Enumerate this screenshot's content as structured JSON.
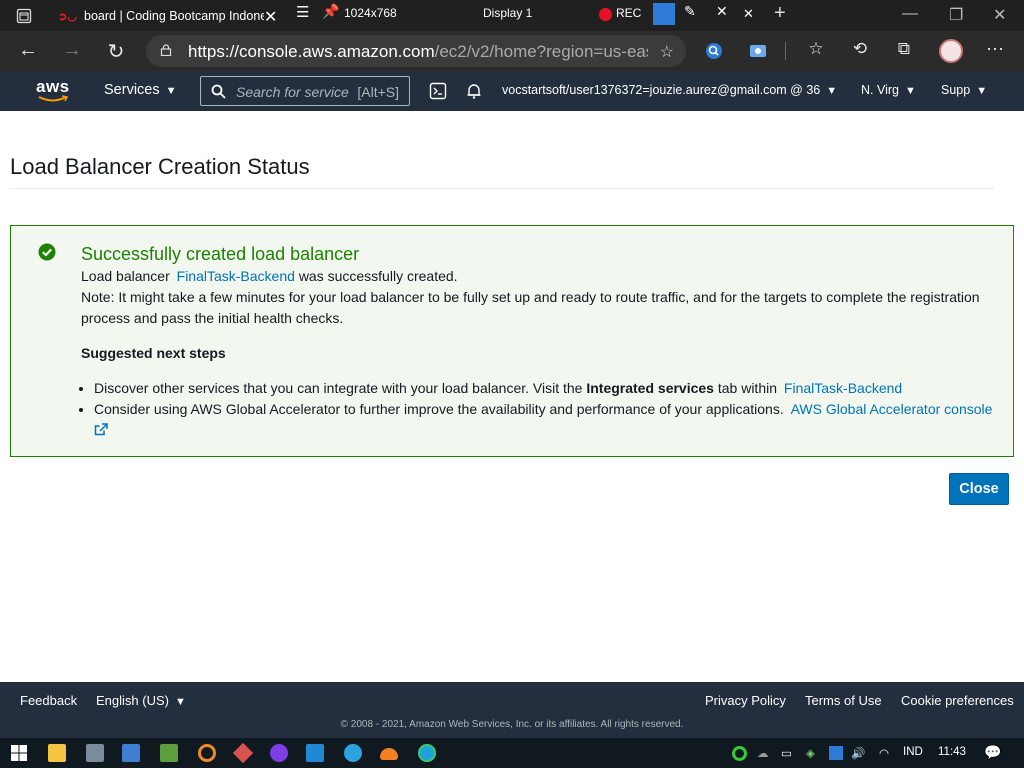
{
  "browser": {
    "tab_title": "board | Coding Bootcamp Indonesia",
    "recorder": {
      "resolution": "1024x768",
      "display": "Display 1",
      "rec_label": "REC"
    },
    "url_main": "https://console.aws.amazon.com",
    "url_rest": "/ec2/v2/home?region=us-eas..."
  },
  "aws_nav": {
    "logo": "aws",
    "services_label": "Services",
    "search_placeholder": "Search for service",
    "search_shortcut": "[Alt+S]",
    "account": "vocstartsoft/user1376372=jouzie.aurez@gmail.com @ 36",
    "region": "N. Virg",
    "support": "Supp"
  },
  "main": {
    "page_title": "Load Balancer Creation Status",
    "alert": {
      "heading": "Successfully created load balancer",
      "created_prefix": "Load balancer",
      "lb_name": "FinalTask-Backend",
      "created_suffix": "was successfully created.",
      "note": "Note: It might take a few minutes for your load balancer to be fully set up and ready to route traffic, and for the targets to complete the registration process and pass the initial health checks.",
      "steps_title": "Suggested next steps",
      "step1_prefix": "Discover other services that you can integrate with your load balancer. Visit the",
      "step1_bold": "Integrated services",
      "step1_middle": "tab within",
      "step1_link": "FinalTask-Backend",
      "step2_prefix": "Consider using AWS Global Accelerator to further improve the availability and performance of your applications.",
      "step2_link": "AWS Global Accelerator console"
    },
    "close_label": "Close"
  },
  "footer": {
    "feedback": "Feedback",
    "language": "English (US)",
    "privacy": "Privacy Policy",
    "terms": "Terms of Use",
    "cookies": "Cookie preferences",
    "copyright": "© 2008 - 2021, Amazon Web Services, Inc. or its affiliates. All rights reserved."
  },
  "taskbar": {
    "language": "IND",
    "time": "11:43"
  },
  "colors": {
    "aws_nav_bg": "#232f3e",
    "success_green": "#1d8102",
    "link_blue": "#0073bb",
    "aws_orange": "#ff9900"
  }
}
